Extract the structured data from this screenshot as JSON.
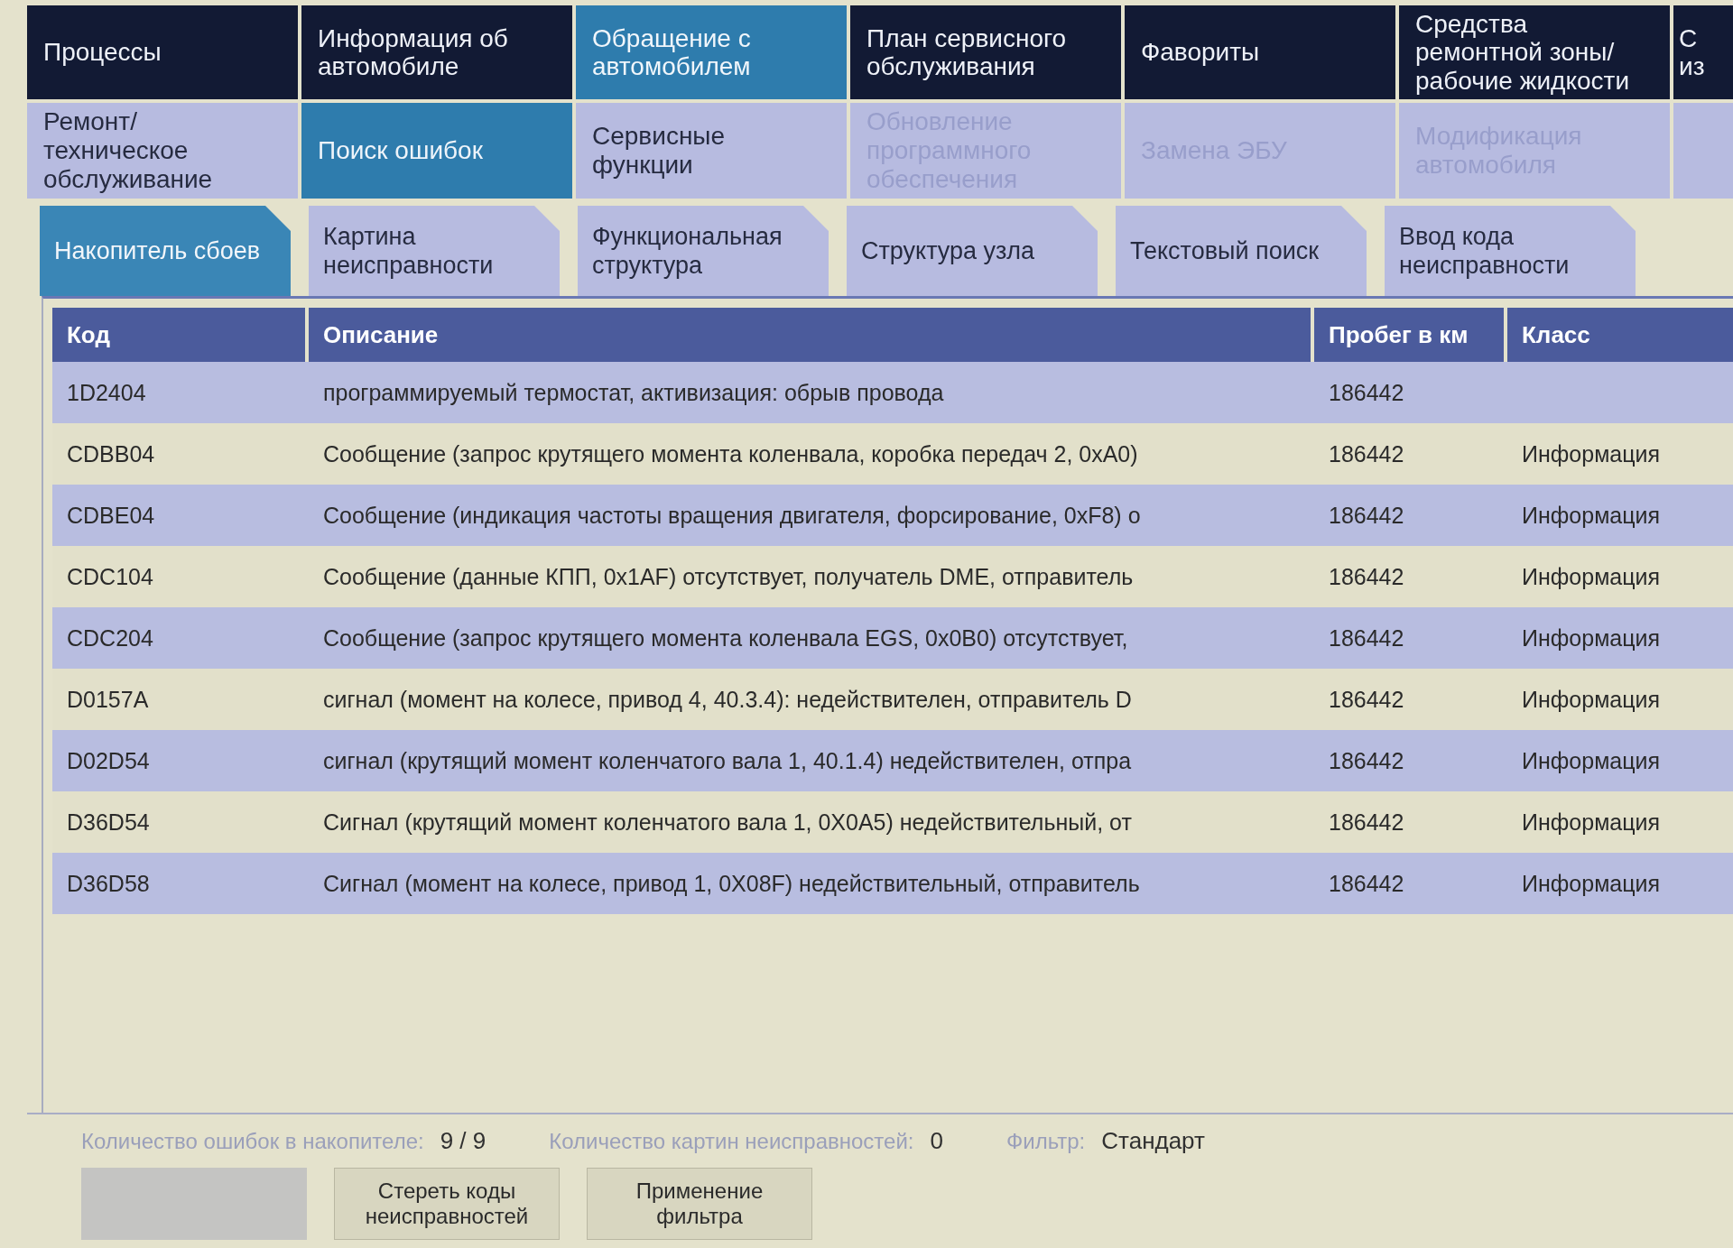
{
  "main_tabs": [
    {
      "label": "Процессы",
      "selected": false
    },
    {
      "label": "Информация об автомобиле",
      "selected": false
    },
    {
      "label": "Обращение с автомобилем",
      "selected": true
    },
    {
      "label": "План сервисного обслуживания",
      "selected": false
    },
    {
      "label": "Фавориты",
      "selected": false
    },
    {
      "label": "Средства ремонтной зоны/ рабочие жидкости",
      "selected": false
    },
    {
      "label": "С из",
      "selected": false
    }
  ],
  "function_tabs": [
    {
      "label": "Ремонт/ техническое обслуживание",
      "selected": false,
      "disabled": false
    },
    {
      "label": "Поиск ошибок",
      "selected": true,
      "disabled": false
    },
    {
      "label": "Сервисные функции",
      "selected": false,
      "disabled": false
    },
    {
      "label": "Обновление программного обеспечения",
      "selected": false,
      "disabled": true
    },
    {
      "label": "Замена ЭБУ",
      "selected": false,
      "disabled": true
    },
    {
      "label": "Модификация автомобиля",
      "selected": false,
      "disabled": true
    }
  ],
  "sub_tabs": [
    {
      "label": "Накопитель сбоев",
      "selected": true
    },
    {
      "label": "Картина неисправности",
      "selected": false
    },
    {
      "label": "Функциональная структура",
      "selected": false
    },
    {
      "label": "Структура узла",
      "selected": false
    },
    {
      "label": "Текстовый поиск",
      "selected": false
    },
    {
      "label": "Ввод кода неисправности",
      "selected": false
    }
  ],
  "table": {
    "columns": [
      "Код",
      "Описание",
      "Пробег в км",
      "Класс"
    ],
    "rows": [
      {
        "code": "1D2404",
        "description": "программируемый термостат, активизация: обрыв провода",
        "mileage": "186442"
      },
      {
        "code": "CDBB04",
        "description": "Сообщение (запрос крутящего момента коленвала, коробка передач 2, 0xA0)",
        "mileage": "186442",
        "class": "Информация"
      },
      {
        "code": "CDBE04",
        "description": "Сообщение (индикация частоты вращения двигателя, форсирование, 0xF8) о",
        "mileage": "186442",
        "class": "Информация"
      },
      {
        "code": "CDC104",
        "description": "Сообщение (данные КПП, 0x1AF) отсутствует, получатель DME, отправитель",
        "mileage": "186442",
        "class": "Информация"
      },
      {
        "code": "CDC204",
        "description": "Сообщение (запрос крутящего момента коленвала EGS, 0x0B0) отсутствует,",
        "mileage": "186442",
        "class": "Информация"
      },
      {
        "code": "D0157A",
        "description": "сигнал (момент на колесе, привод 4, 40.3.4): недействителен, отправитель D",
        "mileage": "186442",
        "class": "Информация"
      },
      {
        "code": "D02D54",
        "description": "сигнал (крутящий момент коленчатого вала 1, 40.1.4) недействителен, отпра",
        "mileage": "186442",
        "class": "Информация"
      },
      {
        "code": "D36D54",
        "description": "Сигнал (крутящий момент коленчатого вала 1, 0X0A5) недействительный, от",
        "mileage": "186442",
        "class": "Информация"
      },
      {
        "code": "D36D58",
        "description": "Сигнал (момент на колесе, привод 1, 0X08F) недействительный, отправитель",
        "mileage": "186442",
        "class": "Информация"
      }
    ]
  },
  "summary": [
    {
      "label": "Количество ошибок в накопителе:",
      "value": "9 / 9"
    },
    {
      "label": "Количество картин неисправностей:",
      "value": "0"
    },
    {
      "label": "Фильтр:",
      "value": "Стандарт"
    }
  ],
  "buttons": [
    {
      "disabled": true
    },
    {
      "label": "Стереть коды неисправностей",
      "disabled": false
    },
    {
      "label": "Применение фильтра",
      "disabled": false
    }
  ]
}
